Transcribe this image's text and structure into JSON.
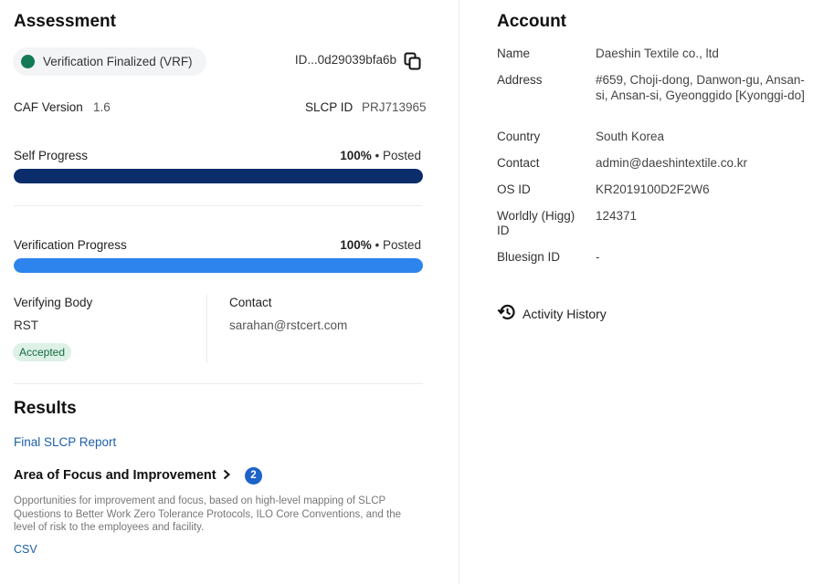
{
  "assessment": {
    "title": "Assessment",
    "status_label": "Verification Finalized (VRF)",
    "status_color": "#137a55",
    "id_text": "ID...0d29039bfa6b",
    "caf_version_label": "CAF Version",
    "caf_version_value": "1.6",
    "slcp_id_label": "SLCP ID",
    "slcp_id_value": "PRJ713965",
    "self_progress": {
      "label": "Self Progress",
      "percent_text": "100%",
      "status_text": "• Posted",
      "fraction": 1.0,
      "color": "#0b2d6b"
    },
    "verification_progress": {
      "label": "Verification Progress",
      "percent_text": "100%",
      "status_text": "• Posted",
      "fraction": 1.0,
      "color": "#2d84ec"
    },
    "verifying_body_label": "Verifying Body",
    "verifying_body_value": "RST",
    "verifying_body_status": "Accepted",
    "contact_label": "Contact",
    "contact_value": "sarahan@rstcert.com"
  },
  "results": {
    "title": "Results",
    "final_report_link": "Final SLCP Report",
    "area_title": "Area of Focus and Improvement",
    "area_count": "2",
    "area_description": "Opportunities for improvement and focus, based on high-level mapping of SLCP Questions to Better Work Zero Tolerance Protocols, ILO Core Conventions, and the level of risk to the employees and facility.",
    "csv_link": "CSV"
  },
  "account": {
    "title": "Account",
    "rows": [
      {
        "label": "Name",
        "value": "Daeshin Textile co., ltd"
      },
      {
        "label": "Address",
        "value": "#659, Choji-dong, Danwon-gu, Ansan-si, Ansan-si, Gyeonggido [Kyonggi-do]"
      },
      {
        "label": "Country",
        "value": "South Korea"
      },
      {
        "label": "Contact",
        "value": "admin@daeshintextile.co.kr"
      },
      {
        "label": "OS ID",
        "value": "KR2019100D2F2W6"
      },
      {
        "label": "Worldly (Higg) ID",
        "value": "124371"
      },
      {
        "label": "Bluesign ID",
        "value": "-"
      }
    ],
    "activity_history_label": "Activity History"
  }
}
